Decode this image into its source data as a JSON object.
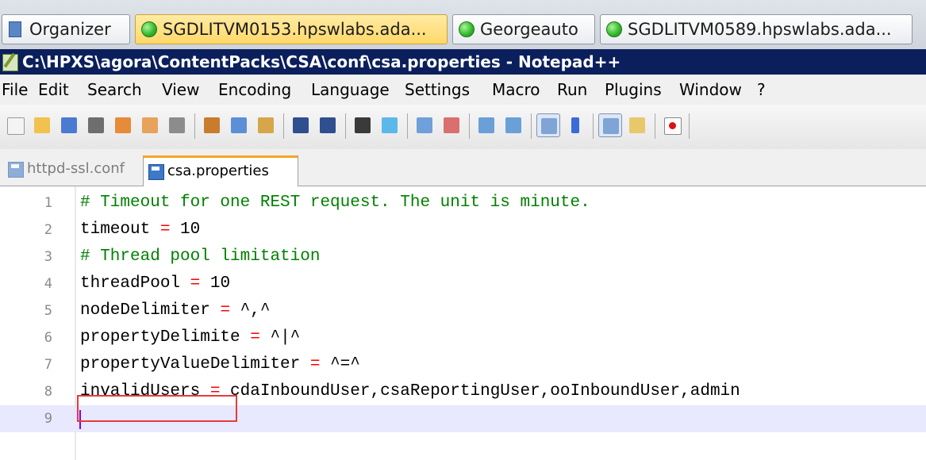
{
  "session_tabs": [
    {
      "label": "Organizer",
      "icon": "organizer-icon",
      "active": false
    },
    {
      "label": "SGDLITVM0153.hpswlabs.ada...",
      "icon": "connected-dot-icon",
      "active": true
    },
    {
      "label": "Georgeauto",
      "icon": "connected-dot-icon",
      "active": false
    },
    {
      "label": "SGDLITVM0589.hpswlabs.ada...",
      "icon": "connected-dot-icon",
      "active": false
    }
  ],
  "window": {
    "title": "C:\\HPXS\\agora\\ContentPacks\\CSA\\conf\\csa.properties - Notepad++"
  },
  "menu": [
    "File",
    "Edit",
    "Search",
    "View",
    "Encoding",
    "Language",
    "Settings",
    "Macro",
    "Run",
    "Plugins",
    "Window",
    "?"
  ],
  "toolbar": {
    "buttons": [
      "new-file",
      "open-file",
      "save",
      "save-all",
      "close",
      "close-all",
      "print",
      "cut",
      "copy",
      "paste",
      "undo",
      "redo",
      "find",
      "replace",
      "zoom-in",
      "zoom-out",
      "sync-vertical",
      "sync-horizontal",
      "word-wrap",
      "show-all-chars",
      "indent-guide",
      "user-lang",
      "record-macro"
    ]
  },
  "doc_tabs": [
    {
      "label": "httpd-ssl.conf",
      "active": false
    },
    {
      "label": "csa.properties",
      "active": true
    }
  ],
  "editor": {
    "lines": [
      {
        "num": "1",
        "parts": [
          {
            "t": "# Timeout for one REST request. The unit is minute.",
            "k": "cmt"
          }
        ]
      },
      {
        "num": "2",
        "parts": [
          {
            "t": "timeout ",
            "k": "key"
          },
          {
            "t": "=",
            "k": "op"
          },
          {
            "t": " 10",
            "k": "val"
          }
        ]
      },
      {
        "num": "3",
        "parts": [
          {
            "t": "# Thread pool limitation",
            "k": "cmt"
          }
        ]
      },
      {
        "num": "4",
        "parts": [
          {
            "t": "threadPool ",
            "k": "key"
          },
          {
            "t": "=",
            "k": "op"
          },
          {
            "t": " 10",
            "k": "val"
          }
        ]
      },
      {
        "num": "5",
        "parts": [
          {
            "t": "nodeDelimiter ",
            "k": "key"
          },
          {
            "t": "=",
            "k": "op"
          },
          {
            "t": " ^,^",
            "k": "val"
          }
        ]
      },
      {
        "num": "6",
        "parts": [
          {
            "t": "propertyDelimite ",
            "k": "key"
          },
          {
            "t": "=",
            "k": "op"
          },
          {
            "t": " ^|^",
            "k": "val"
          }
        ]
      },
      {
        "num": "7",
        "parts": [
          {
            "t": "propertyValueDelimiter ",
            "k": "key"
          },
          {
            "t": "=",
            "k": "op"
          },
          {
            "t": " ^=^",
            "k": "val"
          }
        ]
      },
      {
        "num": "8",
        "parts": [
          {
            "t": "invalidUsers ",
            "k": "key"
          },
          {
            "t": "=",
            "k": "op"
          },
          {
            "t": " cdaInboundUser,csaReportingUser,ooInboundUser,admin",
            "k": "val"
          }
        ]
      },
      {
        "num": "9",
        "parts": [
          {
            "t": "",
            "k": "val"
          }
        ]
      }
    ],
    "current_line": "9",
    "highlighted_token": "invalidUsers"
  },
  "colors": {
    "comment": "#008000",
    "operator": "#ff0000",
    "title_bar": "#0b1f5c",
    "active_session_tab": "#ffd86a",
    "highlight_box": "#e53b3b"
  }
}
